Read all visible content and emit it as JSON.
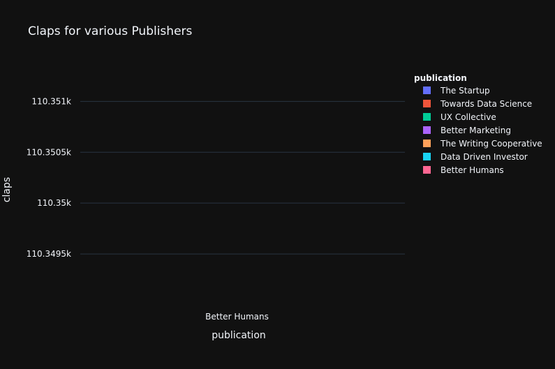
{
  "chart_data": {
    "type": "bar",
    "title": "Claps for various Publishers",
    "xlabel": "publication",
    "ylabel": "claps",
    "categories": [
      "Better Humans"
    ],
    "yticks": [
      110349.5,
      110350,
      110350.5,
      110351
    ],
    "ytick_labels": [
      "110.3495k",
      "110.35k",
      "110.3505k",
      "110.351k"
    ],
    "ylim": [
      110349.0,
      110351.4
    ],
    "grid": true,
    "background": "#111111",
    "gridcolor": "#283442",
    "legend": {
      "title": "publication",
      "placement": "right",
      "entries": [
        {
          "name": "The Startup",
          "color": "#636efa"
        },
        {
          "name": "Towards Data Science",
          "color": "#EF553B"
        },
        {
          "name": "UX Collective",
          "color": "#00cc96"
        },
        {
          "name": "Better Marketing",
          "color": "#ab63fa"
        },
        {
          "name": "The Writing Cooperative",
          "color": "#FFA15A"
        },
        {
          "name": "Data Driven Investor",
          "color": "#19d3f3"
        },
        {
          "name": "Better Humans",
          "color": "#FF6692"
        }
      ]
    }
  }
}
